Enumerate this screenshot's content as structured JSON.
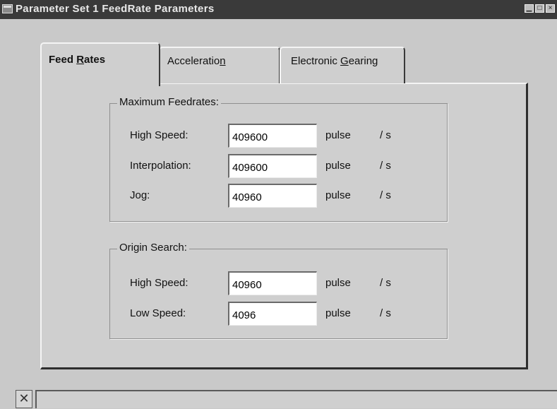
{
  "window": {
    "title": "Parameter Set 1 FeedRate Parameters",
    "controls": [
      "minimize",
      "maximize",
      "close"
    ]
  },
  "tabs": [
    {
      "label": "Feed Rates",
      "mnemonic": "R",
      "active": true
    },
    {
      "label": "Acceleration",
      "mnemonic": "n",
      "active": false
    },
    {
      "label": "Electronic Gearing",
      "mnemonic": "G",
      "active": false
    }
  ],
  "max_feedrates": {
    "title": "Maximum Feedrates:",
    "rows": [
      {
        "label": "High Speed:",
        "value": "409600",
        "unit": "pulse",
        "per": "/ s"
      },
      {
        "label": "Interpolation:",
        "value": "409600",
        "unit": "pulse",
        "per": "/ s"
      },
      {
        "label": "Jog:",
        "value": "40960",
        "unit": "pulse",
        "per": "/ s"
      }
    ]
  },
  "origin_search": {
    "title": "Origin Search:",
    "rows": [
      {
        "label": "High Speed:",
        "value": "40960",
        "unit": "pulse",
        "per": "/ s"
      },
      {
        "label": "Low Speed:",
        "value": "4096",
        "unit": "pulse",
        "per": "/ s"
      }
    ]
  },
  "statusbar": {
    "close_glyph": "✕",
    "text": ""
  },
  "icons": {
    "title_icon": "window-app-icon",
    "minimize": "minimize-icon",
    "maximize": "maximize-icon",
    "close": "close-icon"
  }
}
